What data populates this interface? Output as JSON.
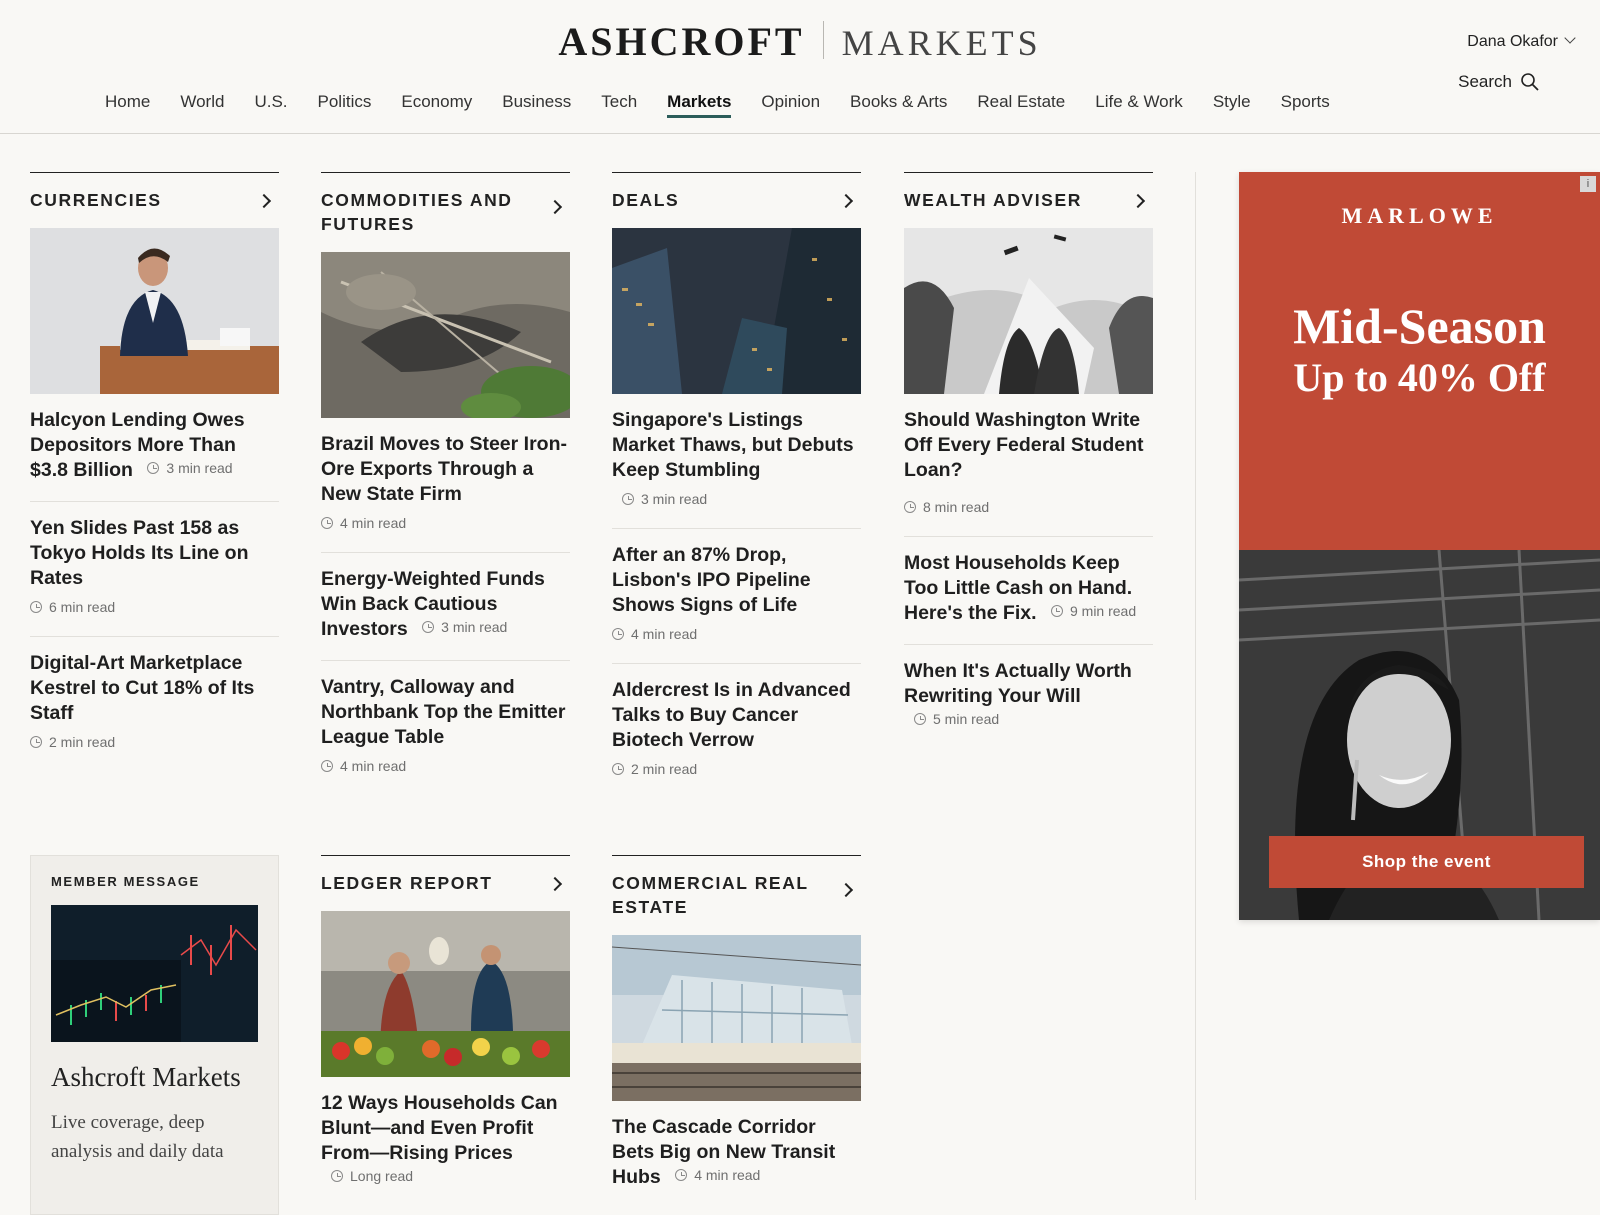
{
  "header": {
    "brand_primary": "ASHCROFT",
    "brand_secondary": "MARKETS",
    "user_name": "Dana Okafor",
    "search_label": "Search"
  },
  "nav": [
    "Home",
    "World",
    "U.S.",
    "Politics",
    "Economy",
    "Business",
    "Tech",
    "Markets",
    "Opinion",
    "Books & Arts",
    "Real Estate",
    "Life & Work",
    "Style",
    "Sports"
  ],
  "nav_active": "Markets",
  "sections": {
    "currencies": {
      "title": "CURRENCIES",
      "image": "businessman-desk-photo",
      "stories": [
        {
          "headline": "Halcyon Lending Owes Depositors More Than $3.8 Billion",
          "read": "3 min read"
        },
        {
          "headline": "Yen Slides Past 158 as Tokyo Holds Its Line on Rates",
          "read": "6 min read"
        },
        {
          "headline": "Digital-Art Marketplace Kestrel to Cut 18% of Its Staff",
          "read": "2 min read"
        }
      ]
    },
    "commodities": {
      "title": "COMMODITIES AND FUTURES",
      "image": "mining-site-aerial-photo",
      "stories": [
        {
          "headline": "Brazil Moves to Steer Iron-Ore Exports Through a New State Firm",
          "read": "4 min read"
        },
        {
          "headline": "Energy-Weighted Funds Win Back Cautious Investors",
          "read": "3 min read"
        },
        {
          "headline": "Vantry, Calloway and Northbank Top the Emitter League Table",
          "read": "4 min read"
        }
      ]
    },
    "deals": {
      "title": "DEALS",
      "image": "skyscrapers-night-photo",
      "stories": [
        {
          "headline": "Singapore's Listings Market Thaws, but Debuts Keep Stumbling",
          "read": "3 min read"
        },
        {
          "headline": "After an 87% Drop, Lisbon's IPO Pipeline Shows Signs of Life",
          "read": "4 min read"
        },
        {
          "headline": "Aldercrest Is in Advanced Talks to Buy Cancer Biotech Verrow",
          "read": "2 min read"
        }
      ]
    },
    "wealth": {
      "title": "WEALTH ADVISER",
      "image": "graduation-caps-photo",
      "stories": [
        {
          "headline": "Should Washington Write Off Every Federal Student Loan?",
          "read": "8 min read"
        },
        {
          "headline": "Most Households Keep Too Little Cash on Hand. Here's the Fix.",
          "read": "9 min read"
        },
        {
          "headline": "When It's Actually Worth Rewriting Your Will",
          "read": "5 min read"
        }
      ]
    },
    "ledger": {
      "title": "LEDGER REPORT",
      "image": "market-stall-photo",
      "stories": [
        {
          "headline": "12 Ways Households Can Blunt—and Even Profit From—Rising Prices",
          "read": "Long read"
        }
      ]
    },
    "cre": {
      "title": "COMMERCIAL REAL ESTATE",
      "image": "transit-station-photo",
      "stories": [
        {
          "headline": "The Cascade Corridor Bets Big on New Transit Hubs",
          "read": "4 min read"
        }
      ]
    }
  },
  "member": {
    "label": "MEMBER MESSAGE",
    "title": "Ashcroft Markets",
    "desc": "Live coverage, deep analysis and daily data"
  },
  "ad": {
    "brand": "MARLOWE",
    "headline1": "Mid-Season",
    "headline2": "Up to 40% Off",
    "cta": "Shop the event",
    "info_icon": "i",
    "accent": "#c04a36"
  }
}
